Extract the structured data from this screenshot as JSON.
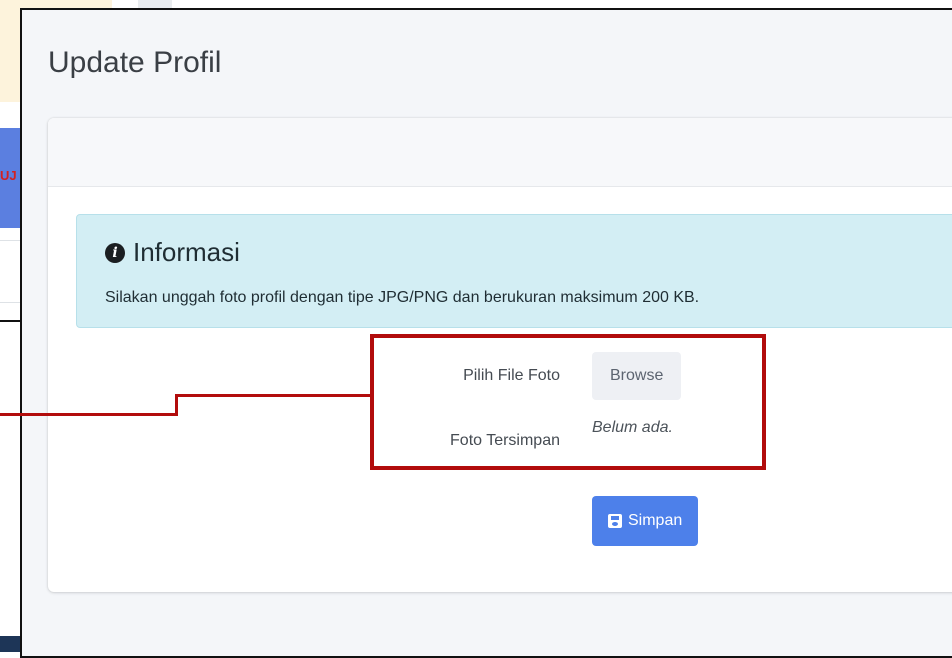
{
  "page": {
    "title": "Update Profil"
  },
  "alert": {
    "icon": "info-circle-icon",
    "title": "Informasi",
    "message": "Silakan unggah foto profil dengan tipe JPG/PNG dan berukuran maksimum 200 KB."
  },
  "form": {
    "file_label": "Pilih File Foto",
    "browse_label": "Browse",
    "saved_label": "Foto Tersimpan",
    "saved_value": "Belum ada."
  },
  "actions": {
    "save_icon": "floppy-disk-icon",
    "save_label": "Simpan"
  },
  "background": {
    "fragment_text": "UJ"
  },
  "colors": {
    "annotation": "#b20c0c",
    "primary_button": "#4d80ea",
    "info_alert": "#d3eef4"
  }
}
